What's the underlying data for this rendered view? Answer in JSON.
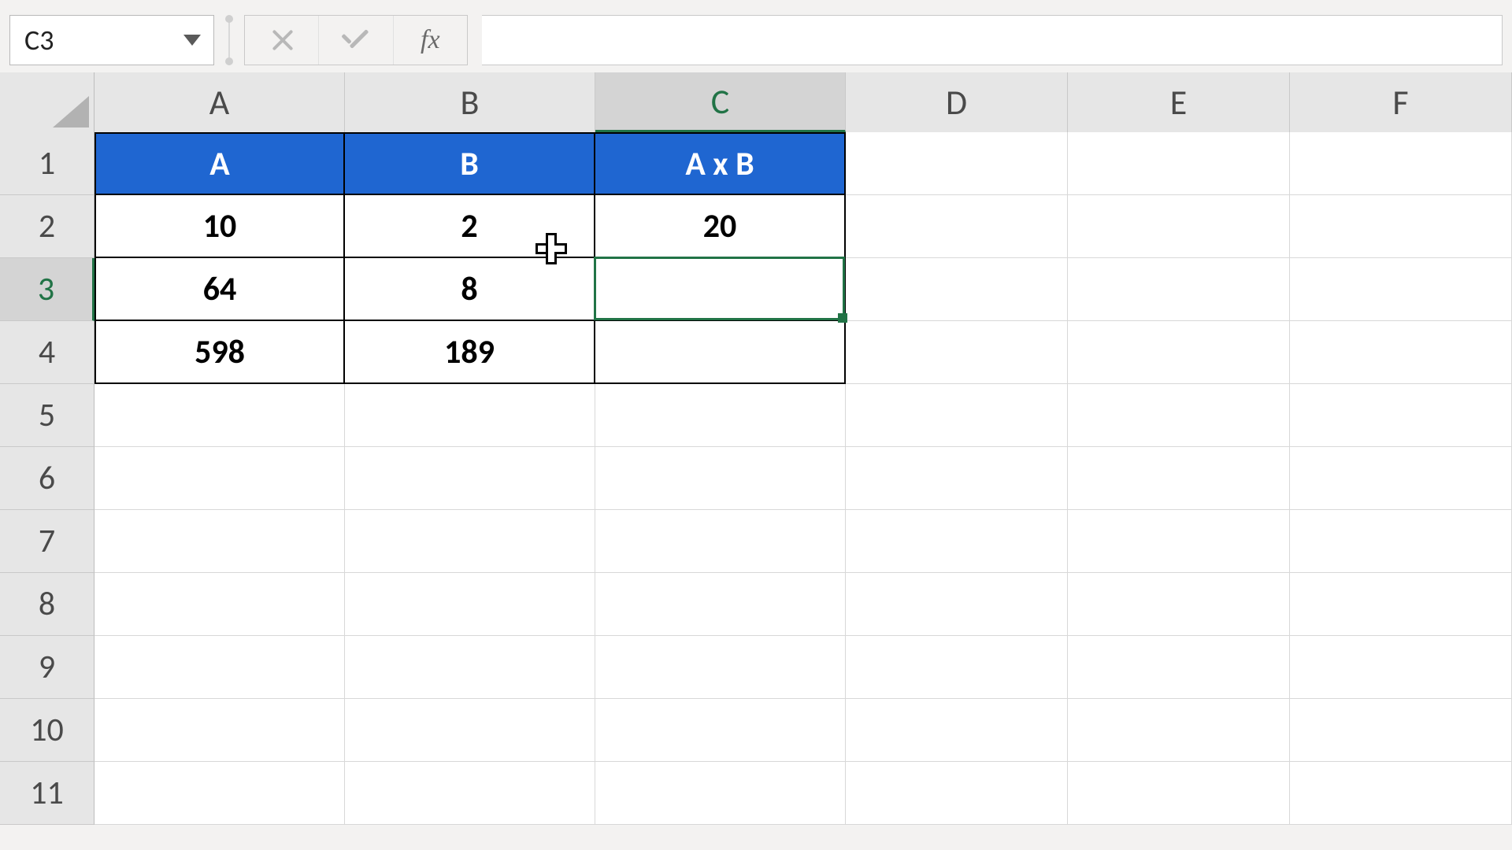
{
  "name_box": {
    "value": "C3"
  },
  "formula_bar": {
    "cancel_title": "Cancel",
    "enter_title": "Enter",
    "fx_label": "fx",
    "formula": ""
  },
  "columns": [
    "A",
    "B",
    "C",
    "D",
    "E",
    "F"
  ],
  "selected_column_index": 2,
  "rows_visible": [
    "1",
    "2",
    "3",
    "4",
    "5",
    "6",
    "7",
    "8",
    "9",
    "10",
    "11"
  ],
  "selected_row_index": 2,
  "active_cell": "C3",
  "table": {
    "headers": {
      "A": "A",
      "B": "B",
      "C": "A x B"
    },
    "data": [
      {
        "A": "10",
        "B": "2",
        "C": "20"
      },
      {
        "A": "64",
        "B": "8",
        "C": ""
      },
      {
        "A": "598",
        "B": "189",
        "C": ""
      }
    ]
  },
  "colors": {
    "header_fill": "#1f66d1",
    "selection_border": "#217346"
  },
  "chart_data": {
    "type": "table",
    "columns": [
      "A",
      "B",
      "A x B"
    ],
    "rows": [
      [
        10,
        2,
        20
      ],
      [
        64,
        8,
        null
      ],
      [
        598,
        189,
        null
      ]
    ]
  }
}
